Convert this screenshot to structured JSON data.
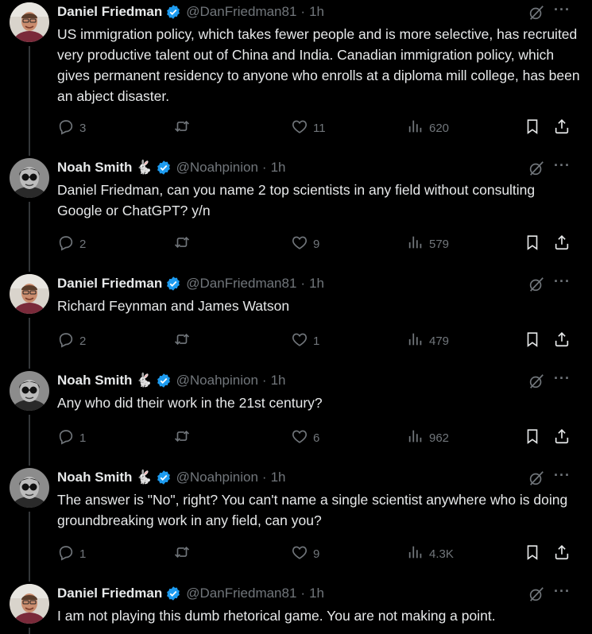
{
  "tweets": [
    {
      "author": "Daniel Friedman",
      "emoji": "",
      "handle": "@DanFriedman81",
      "time": "1h",
      "text": "US immigration policy, which takes fewer people and is more selective, has recruited very productive talent out of China and India. Canadian immigration policy, which gives permanent residency to anyone who enrolls at a diploma mill college, has been an abject disaster.",
      "replies": "3",
      "retweets": "",
      "likes": "11",
      "views": "620",
      "avatar": "daniel"
    },
    {
      "author": "Noah Smith",
      "emoji": "🐇",
      "handle": "@Noahpinion",
      "time": "1h",
      "text": "Daniel Friedman, can you name 2 top scientists in any field without consulting Google or ChatGPT? y/n",
      "replies": "2",
      "retweets": "",
      "likes": "9",
      "views": "579",
      "avatar": "noah"
    },
    {
      "author": "Daniel Friedman",
      "emoji": "",
      "handle": "@DanFriedman81",
      "time": "1h",
      "text": "Richard Feynman and James Watson",
      "replies": "2",
      "retweets": "",
      "likes": "1",
      "views": "479",
      "avatar": "daniel"
    },
    {
      "author": "Noah Smith",
      "emoji": "🐇",
      "handle": "@Noahpinion",
      "time": "1h",
      "text": "Any who did their work in the 21st century?",
      "replies": "1",
      "retweets": "",
      "likes": "6",
      "views": "962",
      "avatar": "noah"
    },
    {
      "author": "Noah Smith",
      "emoji": "🐇",
      "handle": "@Noahpinion",
      "time": "1h",
      "text": "The answer is \"No\", right? You can't name a single scientist anywhere who is doing groundbreaking work in any field, can you?",
      "replies": "1",
      "retweets": "",
      "likes": "9",
      "views": "4.3K",
      "avatar": "noah"
    },
    {
      "author": "Daniel Friedman",
      "emoji": "",
      "handle": "@DanFriedman81",
      "time": "1h",
      "text": "I am not playing this dumb rhetorical game. You are not making a point.",
      "replies": "",
      "retweets": "",
      "likes": "",
      "views": "",
      "avatar": "daniel"
    }
  ],
  "ui": {
    "dot": "·",
    "more": "···"
  },
  "colors": {
    "background": "#000000",
    "text": "#e7e9ea",
    "muted": "#71767b",
    "verified": "#1d9bf0",
    "thread_line": "#333639"
  },
  "icons": [
    "verified-badge-icon",
    "grok-icon",
    "more-icon",
    "reply-icon",
    "retweet-icon",
    "like-icon",
    "views-icon",
    "bookmark-icon",
    "share-icon"
  ]
}
